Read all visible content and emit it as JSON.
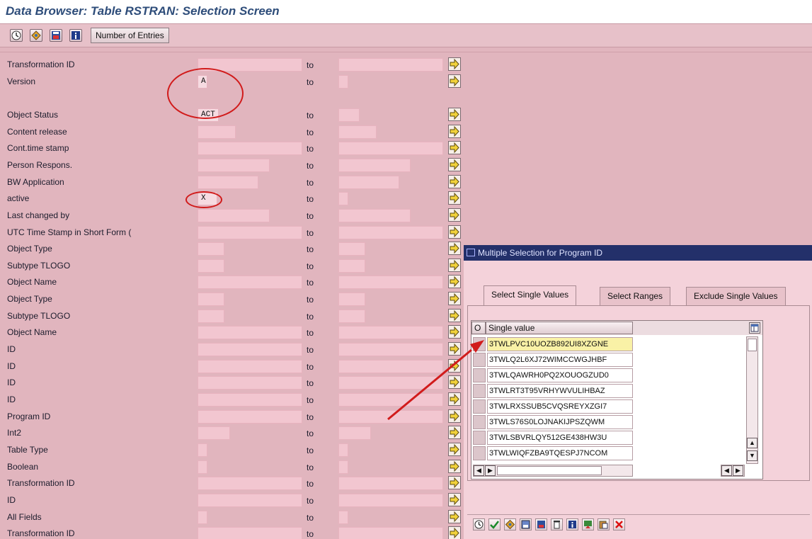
{
  "window": {
    "title": "Data Browser: Table RSTRAN: Selection Screen"
  },
  "toolbar": {
    "icons": [
      "execute-icon",
      "variant-icon",
      "save-icon",
      "info-icon"
    ],
    "number_of_entries_label": "Number of Entries"
  },
  "selection": {
    "to_label": "to",
    "rows": [
      {
        "label": "Transformation ID",
        "from": "",
        "to": ""
      },
      {
        "label": "Version",
        "from": "A",
        "to": ""
      },
      {
        "label": "Object Status",
        "from": "ACT",
        "to": ""
      },
      {
        "label": "Content release",
        "from": "",
        "to": ""
      },
      {
        "label": "Cont.time stamp",
        "from": "",
        "to": ""
      },
      {
        "label": "Person Respons.",
        "from": "",
        "to": ""
      },
      {
        "label": "BW Application",
        "from": "",
        "to": ""
      },
      {
        "label": "active",
        "from": "X",
        "to": ""
      },
      {
        "label": "Last changed by",
        "from": "",
        "to": ""
      },
      {
        "label": "UTC Time Stamp in Short Form (",
        "from": "",
        "to": ""
      },
      {
        "label": "Object Type",
        "from": "",
        "to": ""
      },
      {
        "label": "Subtype TLOGO",
        "from": "",
        "to": ""
      },
      {
        "label": "Object Name",
        "from": "",
        "to": ""
      },
      {
        "label": "Object Type",
        "from": "",
        "to": ""
      },
      {
        "label": "Subtype TLOGO",
        "from": "",
        "to": ""
      },
      {
        "label": "Object Name",
        "from": "",
        "to": ""
      },
      {
        "label": "ID",
        "from": "",
        "to": ""
      },
      {
        "label": "ID",
        "from": "",
        "to": ""
      },
      {
        "label": "ID",
        "from": "",
        "to": ""
      },
      {
        "label": "ID",
        "from": "",
        "to": ""
      },
      {
        "label": "Program ID",
        "from": "",
        "to": ""
      },
      {
        "label": "Int2",
        "from": "",
        "to": ""
      },
      {
        "label": "Table Type",
        "from": "",
        "to": ""
      },
      {
        "label": "Boolean",
        "from": "",
        "to": ""
      },
      {
        "label": "Transformation ID",
        "from": "",
        "to": ""
      },
      {
        "label": "ID",
        "from": "",
        "to": ""
      },
      {
        "label": "All Fields",
        "from": "",
        "to": ""
      },
      {
        "label": "Transformation ID",
        "from": "",
        "to": ""
      }
    ]
  },
  "dialog": {
    "title": "Multiple Selection for Program ID",
    "tabs": [
      "Select Single Values",
      "Select Ranges",
      "Exclude Single Values"
    ],
    "active_tab": "Select Single Values",
    "table": {
      "col_o": "O",
      "col_value": "Single value",
      "values": [
        "3TWLPVC10UOZB892UI8XZGNE",
        "3TWLQ2L6XJ72WIMCCWGJHBF",
        "3TWLQAWRH0PQ2XOUOGZUD0",
        "3TWLRT3T95VRHYWVULIHBAZ",
        "3TWLRXSSUB5CVQSREYXZGI7",
        "3TWLS76S0LOJNAKIJPSZQWM",
        "3TWLSBVRLQY512GE438HW3U",
        "3TWLWIQFZBA9TQESPJ7NCOM"
      ]
    },
    "bottom_icons": [
      "execute-icon",
      "check-icon",
      "variant-icon",
      "copy-icon",
      "save-icon",
      "delete-icon",
      "info-icon",
      "import-icon",
      "paste-icon",
      "cancel-icon"
    ]
  },
  "colors": {
    "annotation": "#d11b1b",
    "dialog_title_bar": "#23306a",
    "selection_bg": "#e1b5be"
  }
}
